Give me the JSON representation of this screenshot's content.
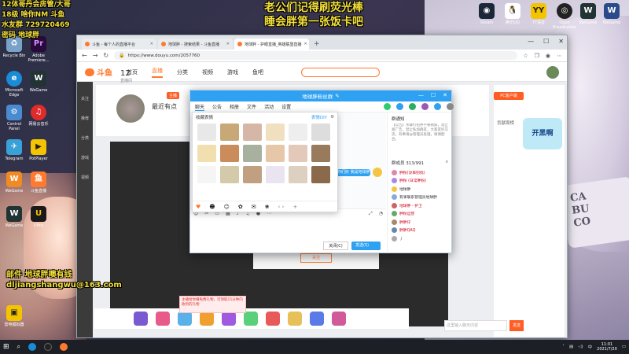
{
  "overlay": {
    "top_line1": "老公们记得刷荧光棒",
    "top_line2": "睡会胖第一张饭卡吧",
    "left_line1": "12体哥丹会房管/大哥",
    "left_line2": "18级 啥你NM 斗鱼",
    "left_line3": "水友群 729720469",
    "left_line4": "密码 地球胖",
    "bottom_line1": "邮件 地球胖噢有钱",
    "bottom_line2": "dljiangshangwu@163.com"
  },
  "desktop_icons": [
    {
      "label": "Recycle Bin"
    },
    {
      "label": "Adobe Premiere..."
    },
    {
      "label": "Microsoft Edge"
    },
    {
      "label": "WeGame"
    },
    {
      "label": "Control Panel"
    },
    {
      "label": "网易云音乐"
    },
    {
      "label": "Telegram"
    },
    {
      "label": "PotPlayer"
    },
    {
      "label": "WeGame"
    },
    {
      "label": "斗鱼直播"
    },
    {
      "label": "WeGame"
    },
    {
      "label": "Ultra"
    },
    {
      "label": "雷电模拟器"
    },
    {
      "label": "Steam"
    },
    {
      "label": "腾讯QQ"
    },
    {
      "label": "YY语音"
    },
    {
      "label": "Open Broadcaster"
    },
    {
      "label": "WeGame"
    },
    {
      "label": "WeGame"
    }
  ],
  "browser": {
    "tabs": [
      {
        "label": "斗鱼 - 每个人的直播平台"
      },
      {
        "label": "地球胖 - 搜索结果 - 斗鱼直播"
      },
      {
        "label": "地球胖 - 护眼直播_英雄联盟直播"
      }
    ],
    "new_tab": "+",
    "url": "https://www.douyu.com/2057760"
  },
  "douyu": {
    "logo": "斗鱼",
    "nav": [
      "首页",
      "直播",
      "分类",
      "视频",
      "游戏",
      "鱼吧"
    ],
    "sidebar": [
      "关注",
      "推荐",
      "分类",
      "游戏",
      "视频"
    ],
    "room_number": "12",
    "room_number_sub": "直播间",
    "room_title": "最近有点",
    "room_badge": "主播",
    "pc_button": "PC客户端",
    "rank_label": "贡献周榜",
    "ad_text": "开黑啊",
    "player_button": "关注",
    "promo_text": "主播给你赚免费礼物，可领取15分钟内收到的礼物",
    "chat_placeholder": "这里输入聊天内容",
    "send_label": "发送"
  },
  "qq": {
    "title": "地球胖粉丝群",
    "toolbar": [
      "聊天",
      "公告",
      "相册",
      "文件",
      "活动",
      "设置"
    ],
    "sent_message": "你们好 我是地球胖",
    "close_label": "关闭(C)",
    "send_label": "发送(S)",
    "notice_title": "群通知",
    "notice_body": "【公告】水群打招呼不要刷屏，禁止发广告，禁止私加群友，大家友好交流，有事请@管理员处理，谢谢配合。",
    "member_count_label": "群成员 313/991",
    "members": [
      {
        "name": "胖粉(没事别找)",
        "red": true
      },
      {
        "name": "胖粉 (日常胖粉)",
        "red": true
      },
      {
        "name": "地球胖",
        "red": false
      },
      {
        "name": "有事联系管理员地球胖",
        "red": false
      },
      {
        "name": "地球胖 - 护卫",
        "red": true
      },
      {
        "name": "胖粉运营",
        "red": true
      },
      {
        "name": "胖胖仔",
        "red": true
      },
      {
        "name": "胖胖QAQ",
        "red": true
      },
      {
        "name": "丿",
        "red": false
      }
    ]
  },
  "emoji": {
    "header": "收藏表情",
    "manage": "表情DIY",
    "cells": [
      "#e8e8e8",
      "#c9a878",
      "#d6b6a6",
      "#f0e0c0",
      "#eeeeee",
      "#dddddd",
      "#f2dfb0",
      "#c98c5a",
      "#a8b0a0",
      "#e6c7a8",
      "#e2c9b9",
      "#9a7a5c",
      "#f5f5f5",
      "#d4c9a8",
      "#c0a080",
      "#e9e4ef",
      "#ddd0c0",
      "#8a6a4a"
    ],
    "footer": [
      "♥",
      "☻",
      "☺",
      "✿",
      "✉",
      "❀",
      "‹ ›",
      "+"
    ]
  },
  "taskbar": {
    "time": "11:01",
    "date": "2021/7/20",
    "lang": "中"
  },
  "colors": {
    "douyu_orange": "#ff7a2f",
    "qq_blue": "#2ea1f2",
    "overlay_yellow": "#f4e03a",
    "member_red": "#d0021b"
  }
}
